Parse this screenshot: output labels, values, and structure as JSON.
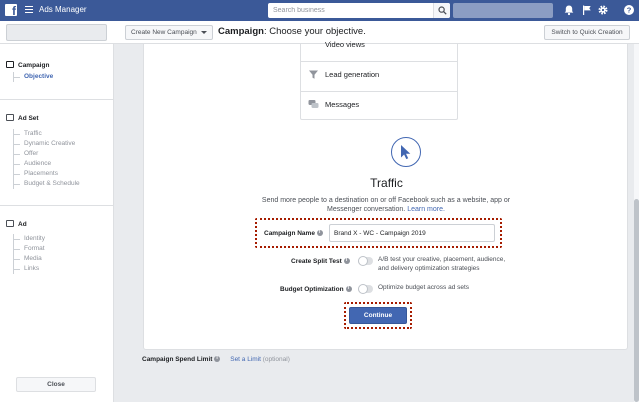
{
  "app": {
    "title": "Ads Manager"
  },
  "search": {
    "placeholder": "Search business"
  },
  "subheader": {
    "create_label": "Create New Campaign",
    "title_bold": "Campaign",
    "title_rest": ": Choose your objective.",
    "quick_label": "Switch to Quick Creation"
  },
  "sidebar": {
    "campaign": {
      "label": "Campaign",
      "items": [
        "Objective"
      ]
    },
    "adset": {
      "label": "Ad Set",
      "items": [
        "Traffic",
        "Dynamic Creative",
        "Offer",
        "Audience",
        "Placements",
        "Budget & Schedule"
      ]
    },
    "ad": {
      "label": "Ad",
      "items": [
        "Identity",
        "Format",
        "Media",
        "Links"
      ]
    },
    "close_label": "Close"
  },
  "objectives": {
    "partial_label": "Video views",
    "items": [
      {
        "label": "Lead generation",
        "icon": "funnel-icon"
      },
      {
        "label": "Messages",
        "icon": "chat-bubbles-icon"
      }
    ]
  },
  "traffic": {
    "title": "Traffic",
    "description": "Send more people to a destination on or off Facebook such as a website, app or Messenger conversation.",
    "learn_more": "Learn more."
  },
  "form": {
    "campaign_name_label": "Campaign Name",
    "campaign_name_value": "Brand X - WC - Campaign 2019",
    "split_test_label": "Create Split Test",
    "split_test_text": "A/B test your creative, placement, audience, and delivery optimization strategies",
    "budget_opt_label": "Budget Optimization",
    "budget_opt_text": "Optimize budget across ad sets",
    "continue_label": "Continue"
  },
  "spend": {
    "label": "Campaign Spend Limit",
    "link": "Set a Limit",
    "optional": "(optional)"
  },
  "colors": {
    "topbar": "#3b5998",
    "accent": "#4267b2",
    "highlight": "#a61c00"
  }
}
